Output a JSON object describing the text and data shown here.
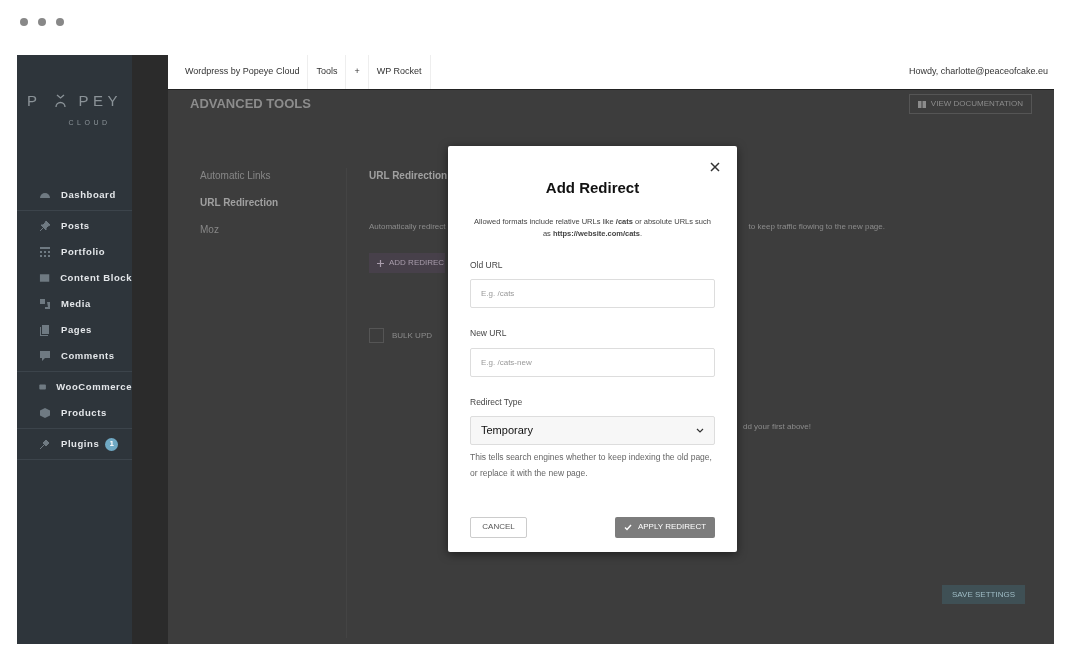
{
  "logo": {
    "left": "P",
    "right": "PEY",
    "sub": "CLOUD"
  },
  "sidebar": {
    "groups": [
      [
        {
          "label": "Dashboard"
        }
      ],
      [
        {
          "label": "Posts"
        },
        {
          "label": "Portfolio"
        },
        {
          "label": "Content Block"
        },
        {
          "label": "Media"
        },
        {
          "label": "Pages"
        },
        {
          "label": "Comments"
        }
      ],
      [
        {
          "label": "WooCommerce"
        },
        {
          "label": "Products"
        }
      ],
      [
        {
          "label": "Plugins",
          "badge": "1"
        }
      ]
    ]
  },
  "topbar": {
    "items": [
      "Wordpress by Popeye Cloud",
      "Tools",
      "+",
      "WP Rocket"
    ],
    "user": "Howdy, charlotte@peaceofcake.eu"
  },
  "page": {
    "title": "ADVANCED TOOLS",
    "doc_button": "VIEW DOCUMENTATION",
    "nav": [
      {
        "label": "Automatic Links",
        "selected": false
      },
      {
        "label": "URL Redirection",
        "selected": true
      },
      {
        "label": "Moz",
        "selected": false
      }
    ],
    "section_title": "URL Redirection",
    "intro_left": "Automatically redirect",
    "intro_right": "to keep traffic flowing to the new page.",
    "add_button": "ADD REDIREC",
    "bulk": {
      "label": "BULK UPD",
      "checked": false
    },
    "empty_right": "dd your first above!",
    "save_button": "SAVE SETTINGS"
  },
  "modal": {
    "title": "Add Redirect",
    "description": "Allowed formats include relative URLs like **/cats** or absolute URLs such as **https://website.com/cats**.",
    "fields": [
      {
        "label": "Old URL",
        "placeholder": "E.g. /cats"
      },
      {
        "label": "New URL",
        "placeholder": "E.g. /cats-new"
      }
    ],
    "select": {
      "label": "Redirect Type",
      "value": "Temporary",
      "help": "This tells search engines whether to keep indexing the old page, or replace it with the new page."
    },
    "cancel": "CANCEL",
    "apply": "APPLY REDIRECT"
  }
}
